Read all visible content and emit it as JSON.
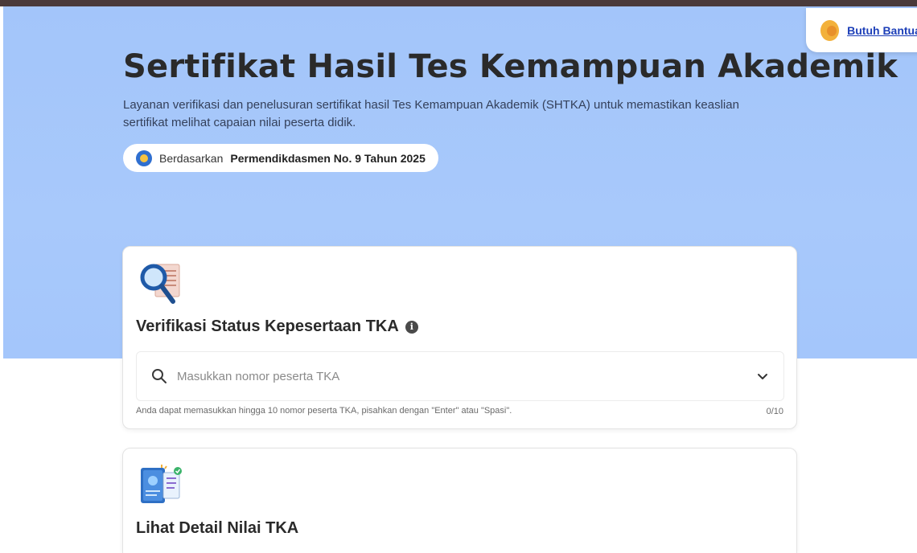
{
  "header": {
    "help_label": "Butuh Bantuan?"
  },
  "hero": {
    "title": "Sertifikat Hasil Tes Kemampuan Akademik",
    "description": "Layanan verifikasi dan penelusuran sertifikat hasil Tes Kemampuan Akademik (SHTKA) untuk memastikan keaslian sertifikat melihat capaian nilai peserta didik.",
    "regulation_prefix": "Berdasarkan",
    "regulation_name": "Permendikdasmen No. 9 Tahun 2025"
  },
  "verification": {
    "title": "Verifikasi Status Kepesertaan TKA",
    "info_glyph": "i",
    "search_placeholder": "Masukkan nomor peserta TKA",
    "search_value": "",
    "hint": "Anda dapat memasukkan hingga 10 nomor peserta TKA, pisahkan dengan \"Enter\" atau \"Spasi\".",
    "counter": "0/10"
  },
  "detail": {
    "title": "Lihat Detail Nilai TKA"
  },
  "icons": {
    "help_avatar": "support-agent-icon",
    "regulation_logo": "ministry-logo-icon",
    "verification": "magnifier-document-icon",
    "info": "info-icon",
    "search": "search-icon",
    "dropdown": "chevron-down-icon",
    "detail": "certificate-book-icon"
  },
  "colors": {
    "hero_background": "#a3c5fa",
    "link": "#1d3fb8",
    "accent_blue": "#2f6fd0"
  }
}
